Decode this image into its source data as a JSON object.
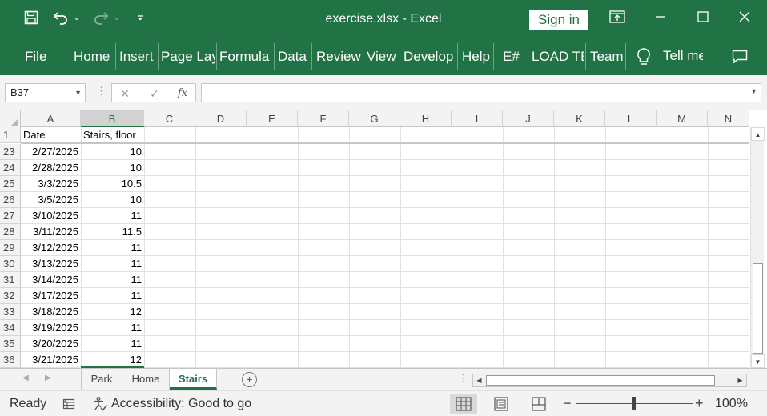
{
  "app": {
    "window_title": "exercise.xlsx  -  Excel",
    "sign_in_label": "Sign in",
    "accent_color": "#217346"
  },
  "quick_access": {
    "save_icon": "save-icon",
    "undo_icon": "undo-icon",
    "redo_icon": "redo-icon",
    "customize_icon": "customize-qat-icon"
  },
  "ribbon": {
    "tabs": [
      "File",
      "Home",
      "Insert",
      "Page Lay",
      "Formula",
      "Data",
      "Review",
      "View",
      "Develop",
      "Help",
      "E#",
      "LOAD TE",
      "Team"
    ],
    "tell_me": "Tell me",
    "tell_me_icon": "lightbulb-icon",
    "comments_icon": "comments-icon"
  },
  "formula_bar": {
    "name_box": "B37",
    "cancel_glyph": "✕",
    "enter_glyph": "✓",
    "fx_label": "fx",
    "formula_value": ""
  },
  "grid": {
    "columns": [
      "A",
      "B",
      "C",
      "D",
      "E",
      "F",
      "G",
      "H",
      "I",
      "J",
      "K",
      "L",
      "M",
      "N"
    ],
    "header_row": {
      "row": "1",
      "a": "Date",
      "b": "Stairs, floor"
    },
    "rows": [
      {
        "row": "23",
        "a": "2/27/2025",
        "b": "10"
      },
      {
        "row": "24",
        "a": "2/28/2025",
        "b": "10"
      },
      {
        "row": "25",
        "a": "3/3/2025",
        "b": "10.5"
      },
      {
        "row": "26",
        "a": "3/5/2025",
        "b": "10"
      },
      {
        "row": "27",
        "a": "3/10/2025",
        "b": "11"
      },
      {
        "row": "28",
        "a": "3/11/2025",
        "b": "11.5"
      },
      {
        "row": "29",
        "a": "3/12/2025",
        "b": "11"
      },
      {
        "row": "30",
        "a": "3/13/2025",
        "b": "11"
      },
      {
        "row": "31",
        "a": "3/14/2025",
        "b": "11"
      },
      {
        "row": "32",
        "a": "3/17/2025",
        "b": "11"
      },
      {
        "row": "33",
        "a": "3/18/2025",
        "b": "12"
      },
      {
        "row": "34",
        "a": "3/19/2025",
        "b": "11"
      },
      {
        "row": "35",
        "a": "3/20/2025",
        "b": "11"
      },
      {
        "row": "36",
        "a": "3/21/2025",
        "b": "12"
      }
    ]
  },
  "sheets": {
    "tabs": [
      "Park",
      "Home",
      "Stairs"
    ],
    "active": "Stairs"
  },
  "status": {
    "ready": "Ready",
    "accessibility": "Accessibility: Good to go",
    "zoom": "100%"
  }
}
